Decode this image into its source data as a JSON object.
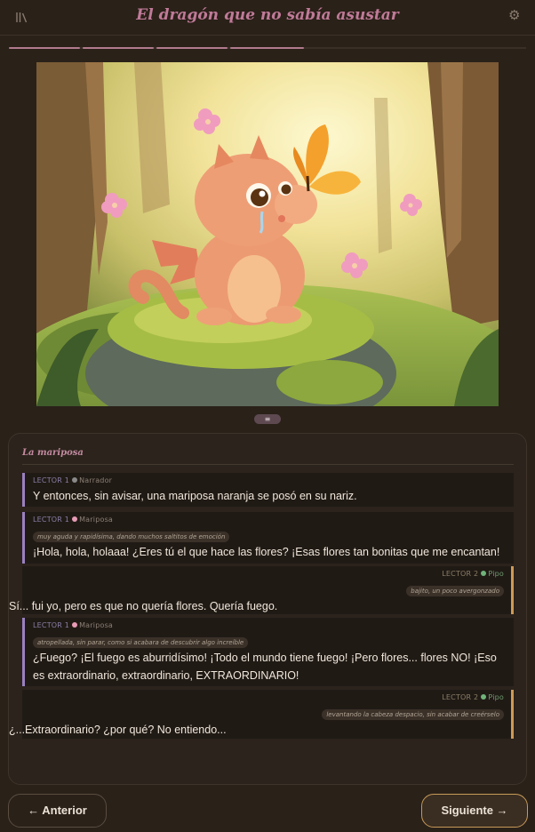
{
  "header": {
    "title": "El dragón que no sabía asustar",
    "left_icon": "library-icon",
    "right_icon": "gear-icon",
    "gear_glyph": "⚙"
  },
  "progress": {
    "total_segments": 4,
    "completed_segments": 4
  },
  "illustration": {
    "subject": "dragón naranja con mariposa en el bosque",
    "colors": {
      "dragon": "#e9936d",
      "butterfly": "#f6a12c",
      "moss": "#9fb84a",
      "light": "#fbf2b5"
    }
  },
  "handle_glyph": "≡",
  "scene": {
    "title": "La mariposa",
    "lines": [
      {
        "reader": "LECTOR 1",
        "character": "Narrador",
        "dot_color": "#8a8a8a",
        "direction": "",
        "text": "Y entonces, sin avisar, una mariposa naranja se posó en su nariz.",
        "side": "left"
      },
      {
        "reader": "LECTOR 1",
        "character": "Mariposa",
        "dot_color": "#e79bb6",
        "direction": "muy aguda y rapidísima, dando muchos saltitos de emoción",
        "text": "¡Hola, hola, holaaa! ¿Eres tú el que hace las flores? ¡Esas flores tan bonitas que me encantan!",
        "side": "left"
      },
      {
        "reader": "LECTOR 2",
        "character": "Pipo",
        "dot_color": "#6fb37a",
        "direction": "bajito, un poco avergonzado",
        "text": "Sí... fui yo, pero es que no quería flores. Quería fuego.",
        "side": "right"
      },
      {
        "reader": "LECTOR 1",
        "character": "Mariposa",
        "dot_color": "#e79bb6",
        "direction": "atropellada, sin parar, como si acabara de descubrir algo increíble",
        "text": "¿Fuego? ¡El fuego es aburridísimo! ¡Todo el mundo tiene fuego! ¡Pero flores... flores NO! ¡Eso es extraordinario, extraordinario, EXTRAORDINARIO!",
        "side": "left"
      },
      {
        "reader": "LECTOR 2",
        "character": "Pipo",
        "dot_color": "#6fb37a",
        "direction": "levantando la cabeza despacio, sin acabar de creérselo",
        "text": "¿...Extraordinario? ¿por qué? No entiendo...",
        "side": "right"
      }
    ]
  },
  "nav": {
    "prev_label": "← Anterior",
    "next_label": "Siguiente →"
  },
  "colors": {
    "accent": "#c07a98",
    "reader1_bar": "#9a80c0",
    "reader2_bar": "#cf9a56",
    "background": "#2a2119"
  }
}
